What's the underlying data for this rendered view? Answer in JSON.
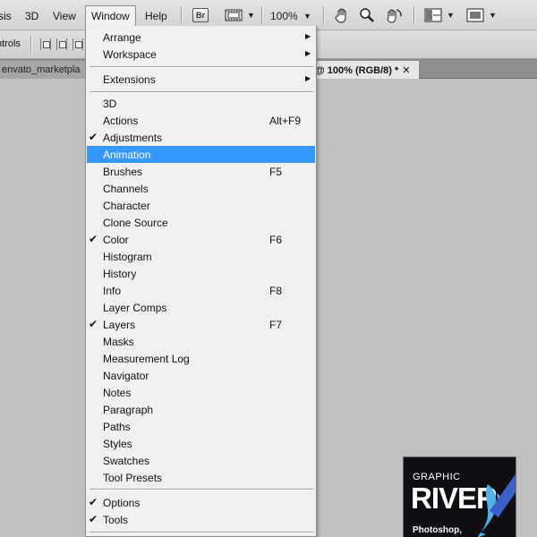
{
  "menubar": {
    "items": [
      "sis",
      "3D",
      "View",
      "Window",
      "Help"
    ],
    "active_item": "Window",
    "bridge_label": "Br",
    "zoom": "100%",
    "icons": [
      "hand-icon",
      "zoom-tool-icon",
      "rotate-view-icon",
      "arrange-documents-icon",
      "screen-mode-icon"
    ]
  },
  "options_bar": {
    "label": "ntrols"
  },
  "tabs": {
    "inactive": "envato_marketpla",
    "active": "@ 100% (RGB/8) *",
    "close_glyph": "✕"
  },
  "window_menu": {
    "items": [
      {
        "label": "Arrange",
        "submenu": true
      },
      {
        "label": "Workspace",
        "submenu": true
      },
      {
        "label": "Extensions",
        "submenu": true
      },
      {
        "label": "3D"
      },
      {
        "label": "Actions",
        "shortcut": "Alt+F9"
      },
      {
        "label": "Adjustments",
        "checked": true
      },
      {
        "label": "Animation",
        "highlighted": true
      },
      {
        "label": "Brushes",
        "shortcut": "F5"
      },
      {
        "label": "Channels"
      },
      {
        "label": "Character"
      },
      {
        "label": "Clone Source"
      },
      {
        "label": "Color",
        "checked": true,
        "shortcut": "F6"
      },
      {
        "label": "Histogram"
      },
      {
        "label": "History"
      },
      {
        "label": "Info",
        "shortcut": "F8"
      },
      {
        "label": "Layer Comps"
      },
      {
        "label": "Layers",
        "checked": true,
        "shortcut": "F7"
      },
      {
        "label": "Masks"
      },
      {
        "label": "Measurement Log"
      },
      {
        "label": "Navigator"
      },
      {
        "label": "Notes"
      },
      {
        "label": "Paragraph"
      },
      {
        "label": "Paths"
      },
      {
        "label": "Styles"
      },
      {
        "label": "Swatches"
      },
      {
        "label": "Tool Presets"
      },
      {
        "label": "Options",
        "checked": true
      },
      {
        "label": "Tools",
        "checked": true
      }
    ],
    "check_glyph": "✔",
    "arrow_glyph": "▶",
    "highlight_color": "#3399ff"
  },
  "badge": {
    "top_text": "GRAPHIC",
    "main_text": "RIVER",
    "sub_text": "Photoshop,"
  }
}
